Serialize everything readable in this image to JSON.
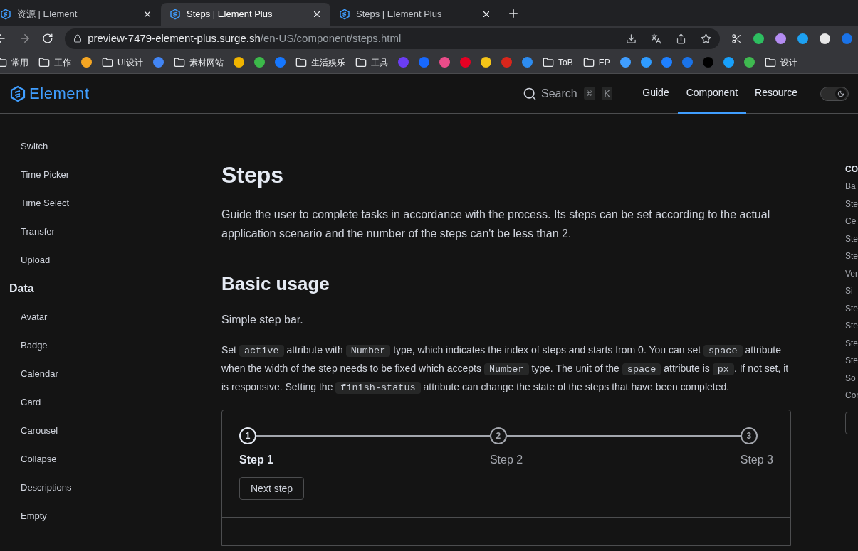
{
  "browser": {
    "tabs": [
      {
        "title": "资源 | Element",
        "selected": false
      },
      {
        "title": "Steps | Element Plus",
        "selected": true
      },
      {
        "title": "Steps | Element Plus",
        "selected": false
      }
    ],
    "url": {
      "host": "preview-7479-element-plus.surge.sh",
      "path": "/en-US/component/steps.html"
    },
    "bookmarks": [
      {
        "kind": "folder",
        "label": "常用"
      },
      {
        "kind": "folder",
        "label": "工作"
      },
      {
        "kind": "site",
        "color": "#f5a623"
      },
      {
        "kind": "folder",
        "label": "UI设计"
      },
      {
        "kind": "site",
        "color": "#4285f4"
      },
      {
        "kind": "folder",
        "label": "素材网站"
      },
      {
        "kind": "site",
        "color": "#f0b400"
      },
      {
        "kind": "site",
        "color": "#3cb94a"
      },
      {
        "kind": "site",
        "color": "#1677ff"
      },
      {
        "kind": "folder",
        "label": "生活娱乐"
      },
      {
        "kind": "folder",
        "label": "工具"
      },
      {
        "kind": "site",
        "color": "#6b3df5"
      },
      {
        "kind": "site",
        "color": "#1769ff"
      },
      {
        "kind": "site",
        "color": "#ea4c89"
      },
      {
        "kind": "site",
        "color": "#e60023"
      },
      {
        "kind": "site",
        "color": "#f5c518"
      },
      {
        "kind": "site",
        "color": "#d9261c"
      },
      {
        "kind": "site",
        "color": "#2d8cf0"
      },
      {
        "kind": "folder",
        "label": "ToB"
      },
      {
        "kind": "folder",
        "label": "EP"
      },
      {
        "kind": "site",
        "color": "#409eff"
      },
      {
        "kind": "site",
        "color": "#2f9bff"
      },
      {
        "kind": "site",
        "color": "#1e80ff"
      },
      {
        "kind": "site",
        "color": "#1a73e8"
      },
      {
        "kind": "site",
        "color": "#000000"
      },
      {
        "kind": "site",
        "color": "#18a0fb"
      },
      {
        "kind": "site",
        "color": "#3fb950"
      },
      {
        "kind": "folder",
        "label": "设计"
      }
    ]
  },
  "header": {
    "logo": "Element",
    "search": {
      "placeholder": "Search",
      "keys": [
        "⌘",
        "K"
      ]
    },
    "nav": [
      {
        "label": "Guide",
        "selected": false
      },
      {
        "label": "Component",
        "selected": true
      },
      {
        "label": "Resource",
        "selected": false
      }
    ],
    "dark_mode": {
      "on": true
    }
  },
  "sidebar": {
    "groups": [
      {
        "items": [
          "Switch",
          "Time Picker",
          "Time Select",
          "Transfer",
          "Upload"
        ]
      },
      {
        "title": "Data",
        "items": [
          "Avatar",
          "Badge",
          "Calendar",
          "Card",
          "Carousel",
          "Collapse",
          "Descriptions",
          "Empty"
        ]
      }
    ]
  },
  "content": {
    "title": "Steps",
    "intro": "Guide the user to complete tasks in accordance with the process. Its steps can be set according to the actual application scenario and the number of the steps can't be less than 2.",
    "section": "Basic usage",
    "lead": "Simple step bar.",
    "description": [
      {
        "kind": "text",
        "text": "Set "
      },
      {
        "kind": "code",
        "text": "active"
      },
      {
        "kind": "text",
        "text": " attribute with "
      },
      {
        "kind": "code",
        "text": "Number"
      },
      {
        "kind": "text",
        "text": " type, which indicates the index of steps and starts from 0. You can set "
      },
      {
        "kind": "code",
        "text": "space"
      },
      {
        "kind": "text",
        "text": " attribute when the width of the step needs to be fixed which accepts "
      },
      {
        "kind": "code",
        "text": "Number"
      },
      {
        "kind": "text",
        "text": " type. The unit of the "
      },
      {
        "kind": "code",
        "text": "space"
      },
      {
        "kind": "text",
        "text": " attribute is "
      },
      {
        "kind": "code",
        "text": "px"
      },
      {
        "kind": "text",
        "text": ". If not set, it is responsive. Setting the "
      },
      {
        "kind": "code",
        "text": "finish-status"
      },
      {
        "kind": "text",
        "text": " attribute can change the state of the steps that have been completed."
      }
    ],
    "demo": {
      "steps": [
        {
          "number": "1",
          "title": "Step 1",
          "active": true
        },
        {
          "number": "2",
          "title": "Step 2",
          "active": false
        },
        {
          "number": "3",
          "title": "Step 3",
          "active": false
        }
      ],
      "button": "Next step"
    }
  },
  "toc": {
    "title": "CO",
    "items": [
      "Ba",
      "Ste",
      "Ce",
      "Ste",
      "Ste",
      "Ver",
      "Si",
      "Ste",
      "Ste",
      "Ste",
      "Ste",
      "So",
      "Cor"
    ]
  }
}
